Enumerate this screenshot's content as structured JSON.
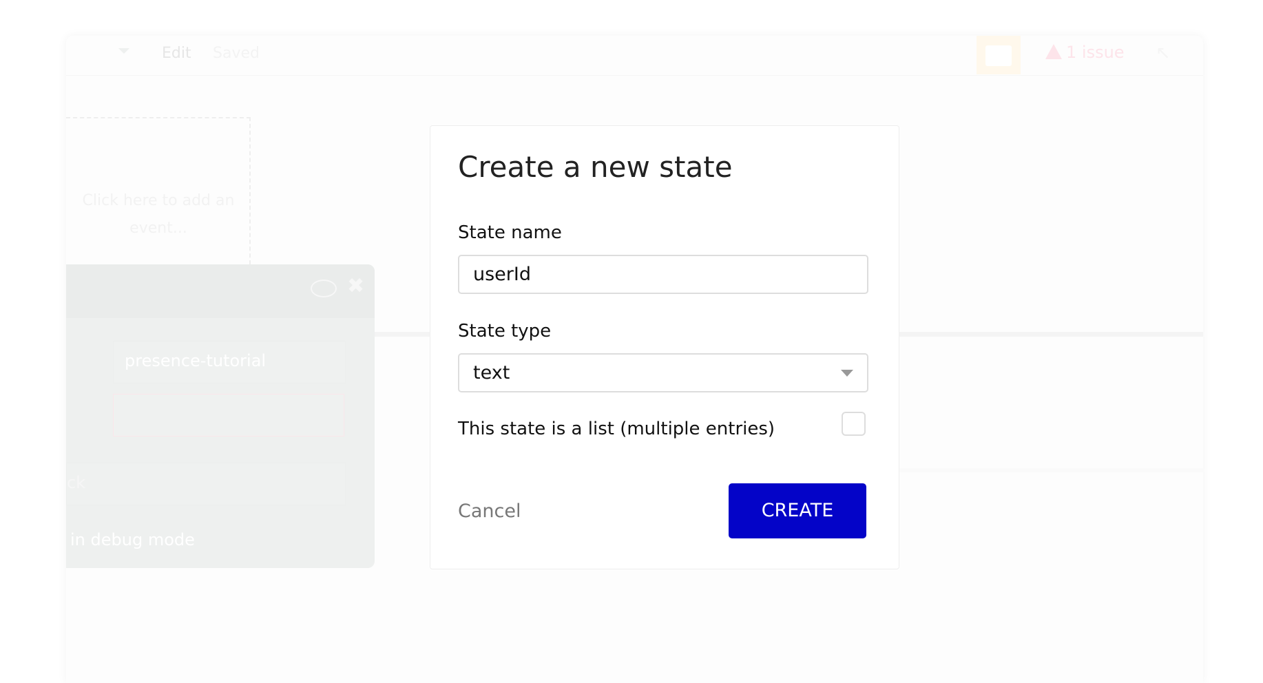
{
  "topbar": {
    "edit_label": "Edit",
    "status": "Saved",
    "issues_label": "1 issue"
  },
  "canvas": {
    "event_placeholder": "Click here to add an event..."
  },
  "property_panel": {
    "app_dropdown": "presence-tutorial",
    "partial_label": "ck",
    "debug_label": "in debug mode"
  },
  "modal": {
    "title": "Create a new state",
    "state_name_label": "State name",
    "state_name_value": "userId",
    "state_type_label": "State type",
    "state_type_value": "text",
    "list_label": "This state is a list (multiple entries)",
    "list_checked": false,
    "cancel_label": "Cancel",
    "create_label": "CREATE"
  },
  "colors": {
    "create_button": "#0404c8",
    "gift_bg": "#fff8ec",
    "issue": "#fde4ea"
  },
  "icons": [
    "chevron-down-icon",
    "gift-icon",
    "warning-icon",
    "pointer-icon",
    "comment-icon",
    "close-icon"
  ]
}
